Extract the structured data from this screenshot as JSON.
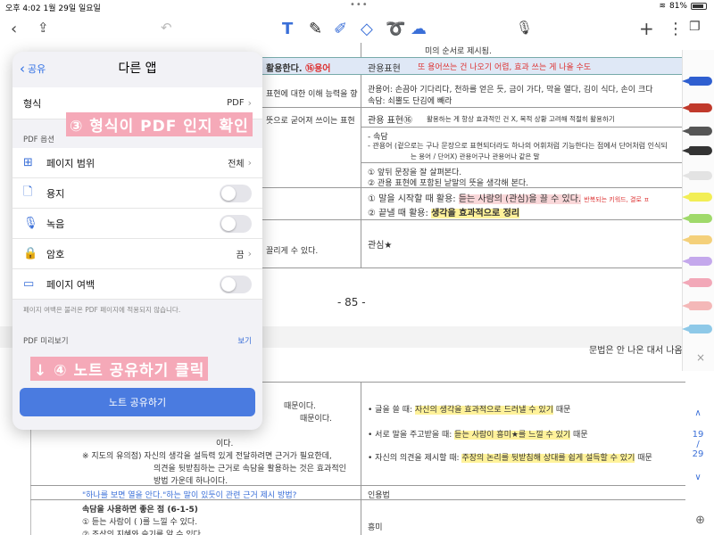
{
  "status": {
    "time": "오후 4:02",
    "date": "1월 29일 일요일",
    "battery": "81%"
  },
  "panel": {
    "back_label": "공유",
    "title": "다른 앱",
    "format_label": "형식",
    "format_value": "PDF",
    "pdf_options_label": "PDF 옵션",
    "page_range_label": "페이지 범위",
    "page_range_value": "전체",
    "paper_label": "용지",
    "recording_label": "녹음",
    "password_label": "암호",
    "password_value": "끔",
    "margin_label": "페이지 여백",
    "margin_note": "페이지 여백은 불러온 PDF 페이지에 적용되지 않습니다.",
    "preview_label": "PDF 미리보기",
    "preview_link": "보기",
    "share_button": "노트 공유하기"
  },
  "annotations": {
    "step3": "③ 형식이 PDF 인지 확인",
    "step4": "↓ ④ 노트 공유하기 클릭"
  },
  "pager": {
    "current": "19",
    "total": "29"
  },
  "doc": {
    "line_top": "미의 순서로 제시됨.",
    "header_left": "활용한다.",
    "header_left_num": "⑯용어",
    "header_mid": "관용표현",
    "header_right": "또 용어쓰는 건 나오기 어렵, 효과 쓰는 게 나올 수도",
    "r1_left": "표현에 대한 이해 능력을 향",
    "r1_right1": "관용어: 손끔아 기다리다, 천하를 얻은 듯, 금이 가다, 막을 열다, 김이 식다, 손이 크다",
    "r1_right2": "속담: 쇠뿔도 단김에 빼라",
    "r2_left": "뜻으로 굳어져 쓰이는 표현",
    "r2_mid": "관용 표현⑯",
    "r2_right": "활용하는 게 항상 효과적인 건 X, 목적 상황 고려해 적절히 활용하기",
    "r3_a": "- 속담",
    "r3_b": "- 관용어 (겉으로는 구나 문장으로 표현되더라도 하나의 어휘처럼 기능한다는 점에서 단어처럼 인식되",
    "r3_c": "는 용어 / 단어X) 관용어구나 관용어나 같은 말",
    "r4_a": "① 앞뒤 문장을 잘 살펴본다.",
    "r4_b": "② 관용 표현에 포함된 낱말의 뜻을 생각해 본다.",
    "r5_a1": "① 말을 시작할 때 활용: ",
    "r5_a2": "듣는 사람의 (관심)을 끌 수 있다.",
    "r5_a3": "반복되는 키워드, 결로 ㅍ",
    "r5_b1": "② 끝낼 때 활용: ",
    "r5_b2": "생각을 효과적으로 정리",
    "r6_left": "끌리게 수 있다.",
    "r6_right": "관심★",
    "page_num": "- 85 -",
    "side_note": "문법은 안 나온 대서 나옴",
    "lower1": "때문이다.",
    "lower2": "때문이다.",
    "lower3": "이다.",
    "lower4": "※ 지도의 유의점) 자신의 생각을 설득력 있게 전달하려면 근거가 필요한데,",
    "lower5": "의견을 뒷받침하는 근거로 속담을 활용하는 것은 효과적인",
    "lower6": "방법 가운데 하나이다.",
    "lower7": "\"하나를 보면 열을 안다.\"하는 말이 있듯이 관련 근거 제시 방법?",
    "lower_r1a": "• 글을 쓸 때: ",
    "lower_r1b": "자신의 생각을 효과적으로 드러낼 수 있기",
    "lower_r1c": " 때문",
    "lower_r2a": "• 서로 말을 주고받을 때: ",
    "lower_r2b": "듣는 사람이 흥미★를 느낄 수 있기",
    "lower_r2c": " 때문",
    "lower_r3a": "• 자신의 의견을 제시할 때: ",
    "lower_r3b": "주장의 논리를 뒷받침해 상대를 쉽게 설득할 수 있기",
    "lower_r3c": " 때문",
    "lower_r4": "인용법",
    "lower8": "속담을 사용하면 좋은 점 (6-1-5)",
    "lower9": "① 듣는 사람이 (    )를 느낄 수 있다.",
    "lower10": "② 조상의 지혜와 슬기를 알 수 있다.",
    "lower_r5": "흥미"
  }
}
